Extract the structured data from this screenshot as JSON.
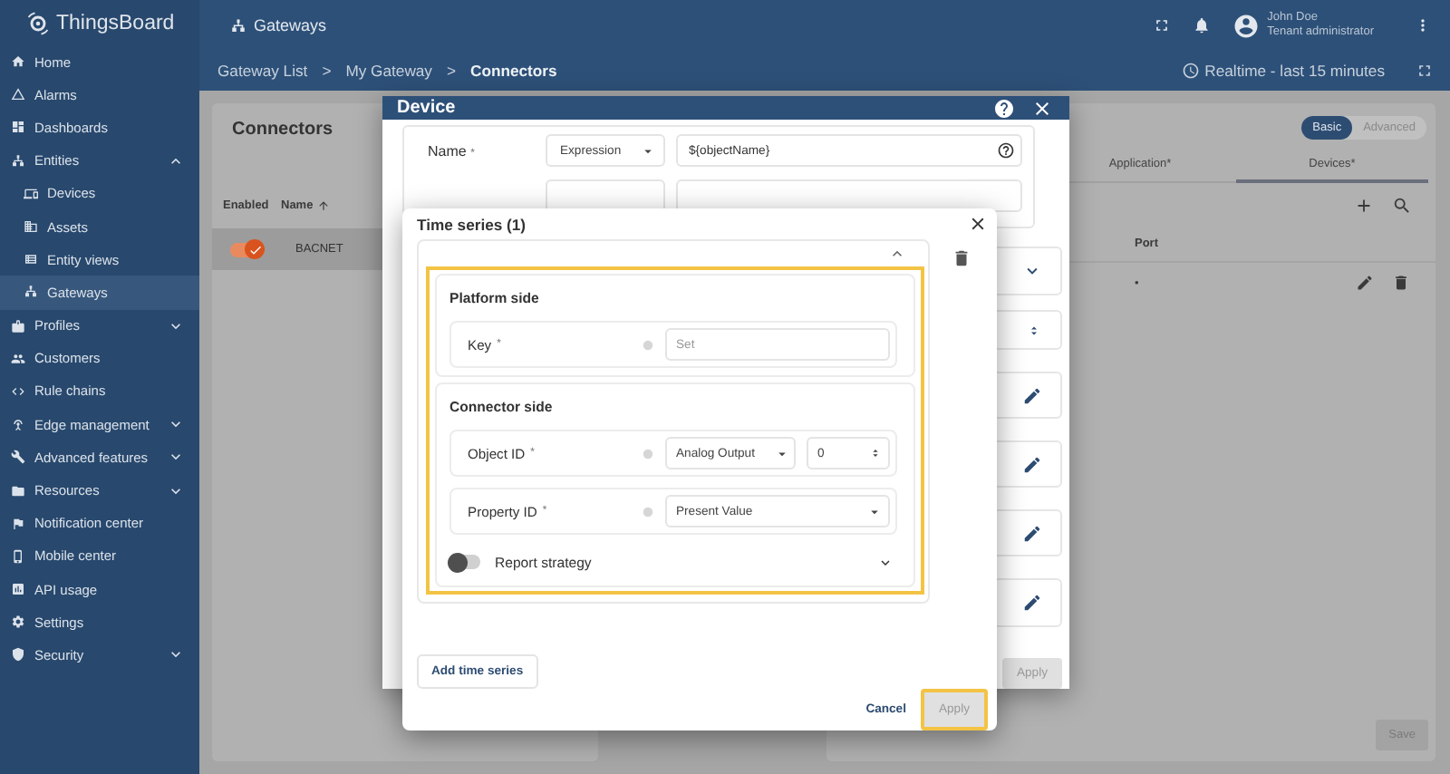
{
  "header": {
    "logo": "ThingsBoard",
    "page_title": "Gateways",
    "user_name": "John Doe",
    "user_role": "Tenant administrator"
  },
  "sidebar": {
    "items": [
      {
        "label": "Home",
        "selected": false
      },
      {
        "label": "Alarms",
        "selected": false
      },
      {
        "label": "Dashboards",
        "selected": false
      },
      {
        "label": "Entities",
        "selected": false,
        "expanded": true,
        "children": [
          {
            "label": "Devices",
            "selected": false
          },
          {
            "label": "Assets",
            "selected": false
          },
          {
            "label": "Entity views",
            "selected": false
          },
          {
            "label": "Gateways",
            "selected": true
          }
        ]
      },
      {
        "label": "Profiles",
        "selected": false,
        "expanded": false
      },
      {
        "label": "Customers",
        "selected": false
      },
      {
        "label": "Rule chains",
        "selected": false
      },
      {
        "label": "Edge management",
        "selected": false,
        "expanded": false
      },
      {
        "label": "Advanced features",
        "selected": false,
        "expanded": false
      },
      {
        "label": "Resources",
        "selected": false,
        "expanded": false
      },
      {
        "label": "Notification center",
        "selected": false
      },
      {
        "label": "Mobile center",
        "selected": false
      },
      {
        "label": "API usage",
        "selected": false
      },
      {
        "label": "Settings",
        "selected": false
      },
      {
        "label": "Security",
        "selected": false,
        "expanded": false
      }
    ]
  },
  "toolbar": {
    "breadcrumb": [
      {
        "label": "Gateway List",
        "separator": ">",
        "selected": false
      },
      {
        "label": "My Gateway",
        "separator": ">",
        "selected": false
      },
      {
        "label": "Connectors",
        "selected": true
      }
    ],
    "time_window": "Realtime - last 15 minutes"
  },
  "connectors": {
    "title": "Connectors",
    "columns": [
      {
        "label": "Enabled",
        "sorted": false
      },
      {
        "label": "Name",
        "sorted": true
      }
    ],
    "rows": [
      {
        "enabled": true,
        "name": "BACNET",
        "selected": true
      }
    ]
  },
  "config_panel": {
    "modes": [
      {
        "label": "Basic",
        "selected": true
      },
      {
        "label": "Advanced",
        "selected": false
      }
    ],
    "tabs": [
      {
        "label": "Application*",
        "selected": false
      },
      {
        "label": "Devices*",
        "selected": true
      }
    ],
    "columns": [
      "Port"
    ],
    "rows": [
      {
        "port": "•"
      }
    ],
    "save_button": {
      "label": "Save",
      "disabled": true
    }
  },
  "device_dialog": {
    "title": "Device",
    "name_field": {
      "label": "Name",
      "required": "*",
      "source": "Expression",
      "value": "${objectName}"
    },
    "apply_button": {
      "label": "Apply",
      "disabled": true
    }
  },
  "time_series_dialog": {
    "title": "Time series (1)",
    "entry": {
      "expanded": true,
      "highlighted": true,
      "sections": [
        {
          "title": "Platform side",
          "rows": [
            {
              "kind": "text",
              "label": "Key",
              "required": "*",
              "placeholder": "Set"
            }
          ]
        },
        {
          "title": "Connector side",
          "rows": [
            {
              "kind": "select_number",
              "label": "Object ID",
              "required": "*",
              "select": "Analog Output",
              "value": "0"
            },
            {
              "kind": "select",
              "label": "Property ID",
              "required": "*",
              "select": "Present Value"
            }
          ]
        }
      ],
      "report_strategy": {
        "label": "Report strategy",
        "on": false,
        "expanded": false
      }
    },
    "add_button": "Add time series",
    "cancel_button": "Cancel",
    "apply_button": {
      "label": "Apply",
      "disabled": true,
      "highlighted": true
    }
  }
}
